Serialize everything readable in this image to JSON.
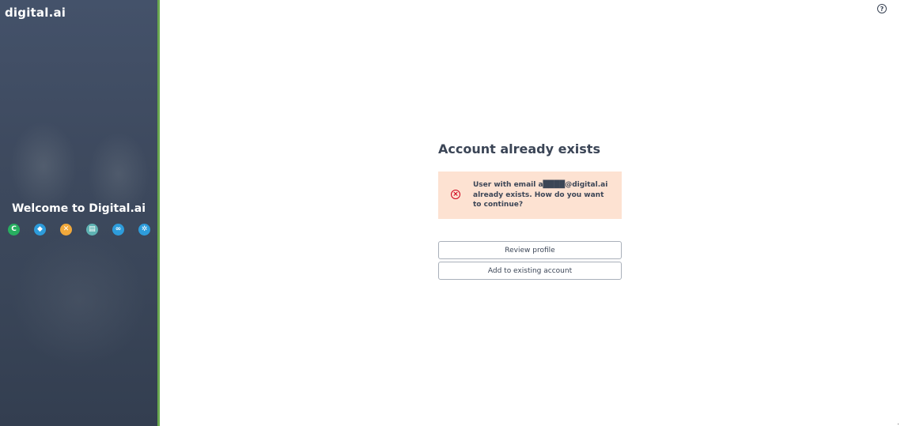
{
  "sidebar": {
    "logo_text": "digital.ai",
    "welcome_text": "Welcome to Digital.ai",
    "accent_color": "#6aa84f",
    "product_icons": [
      {
        "name": "product-icon-1",
        "color": "#27ae60",
        "glyph": "C"
      },
      {
        "name": "product-icon-2",
        "color": "#2d9cdb",
        "glyph": "◆"
      },
      {
        "name": "product-icon-3",
        "color": "#f2a93b",
        "glyph": "✕"
      },
      {
        "name": "product-icon-4",
        "color": "#5fb3b3",
        "glyph": "▤"
      },
      {
        "name": "product-icon-5",
        "color": "#2d9cdb",
        "glyph": "∞"
      },
      {
        "name": "product-icon-6",
        "color": "#2d9cdb",
        "glyph": "✲"
      }
    ]
  },
  "header": {
    "help_icon": "help-circle-icon",
    "help_glyph": "?"
  },
  "main": {
    "title": "Account already exists",
    "alert": {
      "icon": "error-circle-icon",
      "icon_glyph": "×",
      "message": "User with email a​████@digital.ai already exists. How do you want to continue?",
      "background": "#fde2d2",
      "icon_color": "#d0021b"
    },
    "buttons": {
      "review_profile": "Review profile",
      "add_to_existing": "Add to existing account"
    }
  }
}
